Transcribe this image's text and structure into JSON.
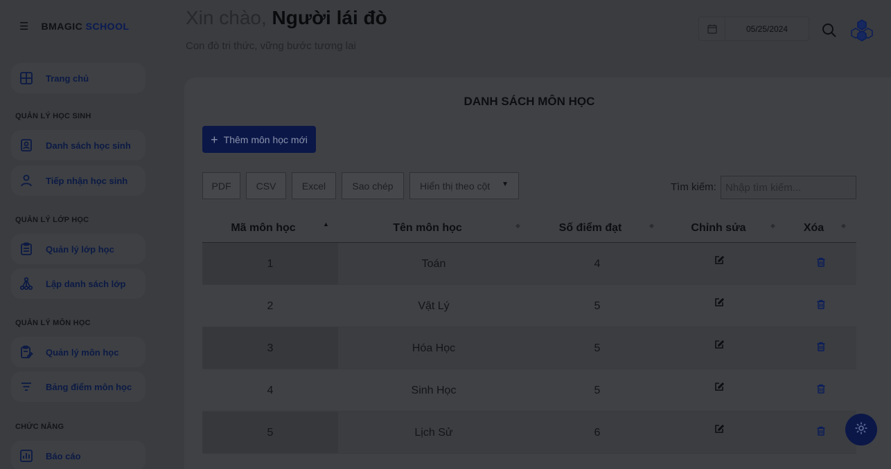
{
  "brand": {
    "prefix": "BMAGIC",
    "suffix": "SCHOOL"
  },
  "sidebar": {
    "home": "Trang chủ",
    "sections": [
      {
        "title": "QUẢN LÝ HỌC SINH",
        "items": [
          "Danh sách học sinh",
          "Tiếp nhận học sinh"
        ]
      },
      {
        "title": "QUẢN LÝ LỚP HỌC",
        "items": [
          "Quản lý lớp học",
          "Lập danh sách lớp"
        ]
      },
      {
        "title": "QUẢN LÝ MÔN HỌC",
        "items": [
          "Quản lý môn học",
          "Bảng điểm môn học"
        ]
      },
      {
        "title": "CHỨC NĂNG",
        "items": [
          "Báo cáo"
        ]
      }
    ]
  },
  "header": {
    "greeting": "Xin chào,",
    "user_name": "Người lái đò",
    "subtitle": "Con đò tri thức, vững bước tương lai",
    "date": "05/25/2024"
  },
  "main": {
    "title": "DANH SÁCH MÔN HỌC",
    "add_button": "Thêm môn học mới",
    "toolbar": {
      "pdf": "PDF",
      "csv": "CSV",
      "excel": "Excel",
      "copy": "Sao chép",
      "colvis": "Hiển thị theo cột"
    },
    "search": {
      "label": "Tìm kiếm:",
      "placeholder": "Nhập tìm kiếm..."
    },
    "table": {
      "headers": [
        "Mã môn học",
        "Tên môn học",
        "Số điểm đạt",
        "Chỉnh sửa",
        "Xóa"
      ],
      "rows": [
        {
          "id": "1",
          "name": "Toán",
          "score": "4"
        },
        {
          "id": "2",
          "name": "Vật Lý",
          "score": "5"
        },
        {
          "id": "3",
          "name": "Hóa Học",
          "score": "5"
        },
        {
          "id": "4",
          "name": "Sinh Học",
          "score": "5"
        },
        {
          "id": "5",
          "name": "Lịch Sử",
          "score": "6"
        }
      ]
    }
  },
  "colors": {
    "brand_navy": "#0b1747",
    "overlay_bg": "#3a3c40"
  }
}
